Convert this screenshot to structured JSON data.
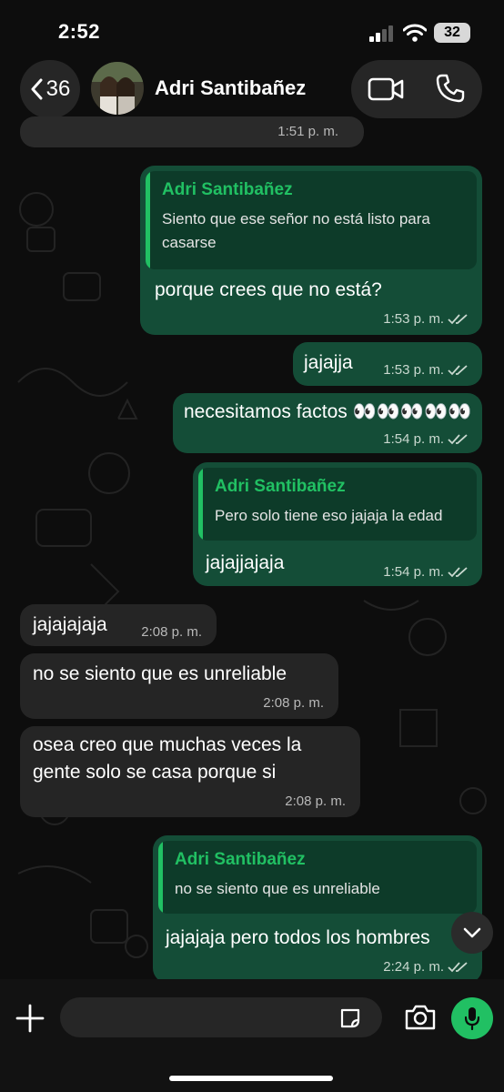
{
  "status_bar": {
    "time": "2:52",
    "battery": "32"
  },
  "header": {
    "back_count": "36",
    "contact_name": "Adri Santibañez"
  },
  "top_partial": {
    "time": "1:51 p. m."
  },
  "messages": [
    {
      "direction": "out",
      "quote_author": "Adri Santibañez",
      "quote_line1": "Siento que ese señor no está listo para",
      "quote_line2": "casarse",
      "text": "porque crees que no está?",
      "time": "1:53 p. m."
    },
    {
      "direction": "out",
      "text": "jajajja",
      "time": "1:53 p. m."
    },
    {
      "direction": "out",
      "text": "necesitamos factos 👀👀👀👀👀",
      "time": "1:54 p. m."
    },
    {
      "direction": "out",
      "quote_author": "Adri Santibañez",
      "quote_line1": "Pero solo tiene eso jajaja la edad",
      "text": "jajajjajaja",
      "time": "1:54 p. m."
    },
    {
      "direction": "in",
      "text": "jajajajaja",
      "time": "2:08 p. m."
    },
    {
      "direction": "in",
      "text": "no se siento que es unreliable",
      "time": "2:08 p. m."
    },
    {
      "direction": "in",
      "line1": "osea creo que muchas veces la",
      "line2": "gente solo se casa porque si",
      "time": "2:08 p. m."
    },
    {
      "direction": "out",
      "quote_author": "Adri Santibañez",
      "quote_line1": "no se siento que es unreliable",
      "text": "jajajaja pero todos los hombres",
      "time": "2:24 p. m."
    }
  ],
  "input": {
    "placeholder": ""
  },
  "colors": {
    "accent": "#21c063",
    "outgoing_bubble": "#144d37",
    "incoming_bubble": "#252525",
    "background": "#0d0d0d"
  },
  "icons": [
    "chevron-left-icon",
    "video-call-icon",
    "phone-icon",
    "plus-icon",
    "sticker-icon",
    "camera-icon",
    "microphone-icon",
    "chevron-down-icon",
    "double-check-icon",
    "cellular-signal-icon",
    "wifi-icon",
    "battery-icon"
  ]
}
